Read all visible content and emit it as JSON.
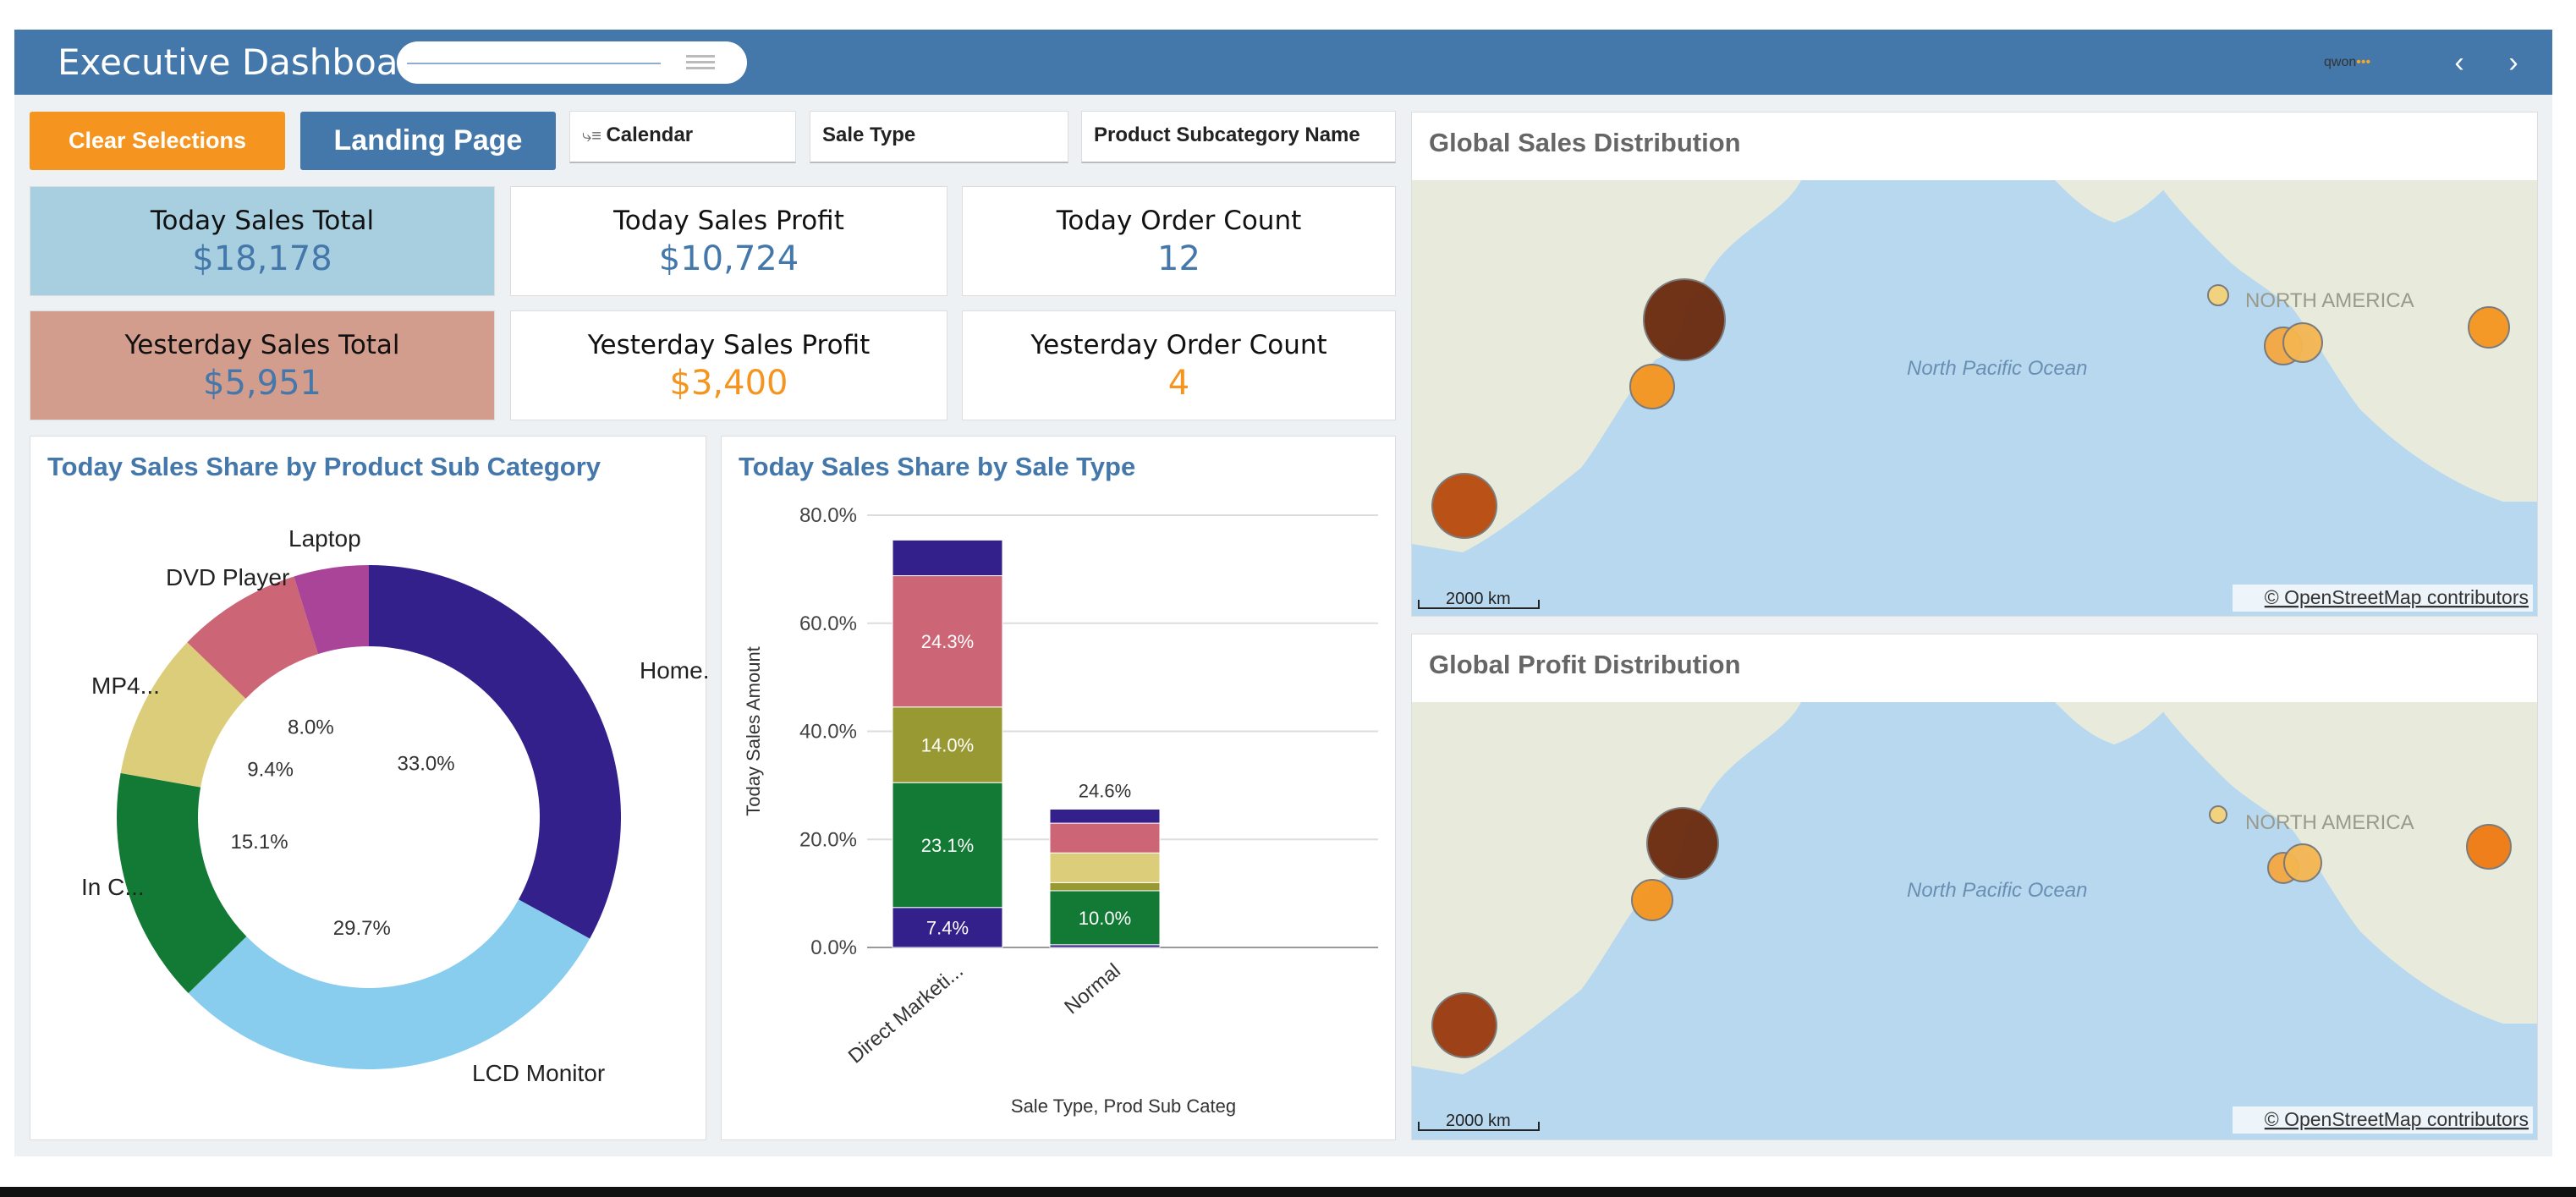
{
  "header": {
    "title": "Executive Dashboard",
    "logo_text": "qwon",
    "logo_dots": "•••",
    "prev_icon": "chevron-left-icon",
    "next_icon": "chevron-right-icon"
  },
  "toolbar": {
    "clear_label": "Clear Selections",
    "landing_label": "Landing Page",
    "filters": [
      {
        "label": "Calendar",
        "icon": "hierarchy-icon"
      },
      {
        "label": "Sale Type"
      },
      {
        "label": "Product Subcategory Name"
      }
    ]
  },
  "kpis": [
    {
      "label": "Today Sales Total",
      "value": "$18,178"
    },
    {
      "label": "Today Sales Profit",
      "value": "$10,724"
    },
    {
      "label": "Today Order Count",
      "value": "12"
    },
    {
      "label": "Yesterday Sales Total",
      "value": "$5,951"
    },
    {
      "label": "Yesterday Sales Profit",
      "value": "$3,400"
    },
    {
      "label": "Yesterday Order Count",
      "value": "4"
    }
  ],
  "colors": {
    "header": "#4477aa",
    "orange": "#f5951f",
    "today_tile": "#a8cfe0",
    "yesterday_tile": "#d39d8d"
  },
  "donut": {
    "title": "Today Sales Share by Product Sub Category",
    "chart_data": {
      "type": "pie",
      "slices": [
        {
          "name": "Home...",
          "value": 33.0,
          "label": "33.0%",
          "color": "#33208b"
        },
        {
          "name": "LCD Monitor",
          "value": 29.7,
          "label": "29.7%",
          "color": "#88ccee"
        },
        {
          "name": "In C...",
          "value": 15.1,
          "label": "15.1%",
          "color": "#137a35"
        },
        {
          "name": "MP4...",
          "value": 9.4,
          "label": "9.4%",
          "color": "#dccd7a"
        },
        {
          "name": "DVD Player",
          "value": 8.0,
          "label": "8.0%",
          "color": "#cc6677"
        },
        {
          "name": "Laptop",
          "value": 4.8,
          "label": "",
          "color": "#aa4499"
        }
      ]
    }
  },
  "bar": {
    "title": "Today Sales Share by Sale Type",
    "chart_data": {
      "type": "bar",
      "stacked": true,
      "categories": [
        "Direct Marketi...",
        "Normal"
      ],
      "series": [
        {
          "values": [
            7.4,
            0.5
          ],
          "color": "#33208b"
        },
        {
          "values": [
            23.1,
            10.0
          ],
          "color": "#137a35"
        },
        {
          "values": [
            14.0,
            1.5
          ],
          "color": "#999933"
        },
        {
          "values": [
            0,
            5.5
          ],
          "color": "#dccd7a"
        },
        {
          "values": [
            24.3,
            5.5
          ],
          "color": "#cc6677"
        },
        {
          "values": [
            6.6,
            2.6
          ],
          "color": "#33208b"
        }
      ],
      "segment_labels": [
        {
          "cat": 0,
          "series": 0,
          "text": "7.4%"
        },
        {
          "cat": 0,
          "series": 1,
          "text": "23.1%"
        },
        {
          "cat": 0,
          "series": 2,
          "text": "14.0%"
        },
        {
          "cat": 0,
          "series": 4,
          "text": "24.3%"
        },
        {
          "cat": 1,
          "series": 1,
          "text": "10.0%"
        }
      ],
      "totals": [
        "",
        "24.6%"
      ],
      "yticks": [
        "0.0%",
        "20.0%",
        "40.0%",
        "60.0%",
        "80.0%"
      ],
      "ylim": [
        0,
        80
      ],
      "ylabel": "Today Sales Amount",
      "xlabel": "Sale Type, Prod Sub Categ"
    }
  },
  "maps": [
    {
      "title": "Global Sales Distribution",
      "ocean_label": "North Pacific Ocean",
      "continent_label": "NORTH AMERICA",
      "scale_label": "2000 km",
      "attribution": "© OpenStreetMap contributors"
    },
    {
      "title": "Global Profit Distribution",
      "ocean_label": "North Pacific Ocean",
      "continent_label": "NORTH AMERICA",
      "scale_label": "2000 km",
      "attribution": "© OpenStreetMap contributors"
    }
  ]
}
